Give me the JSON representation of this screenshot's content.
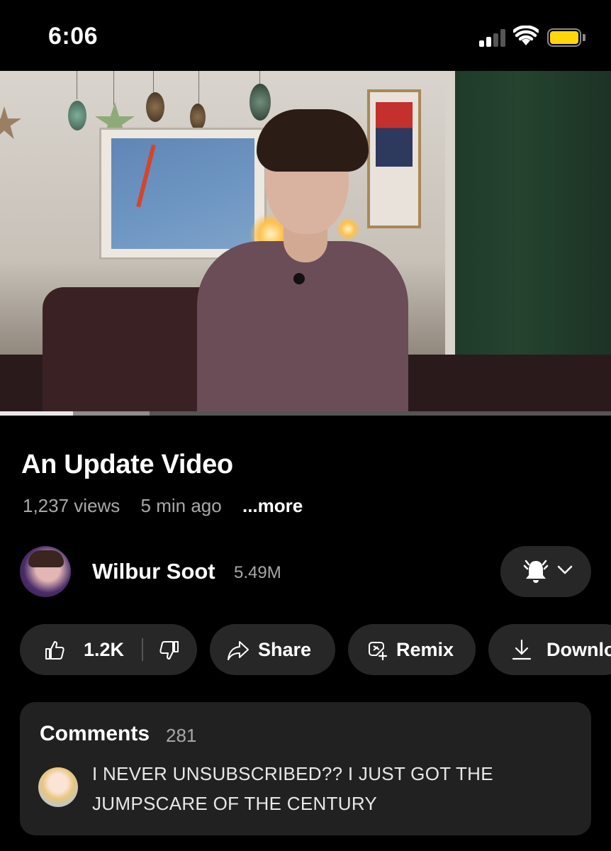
{
  "status_bar": {
    "time": "6:06",
    "battery_color": "#ffd60a",
    "icons": [
      "cellular-signal-icon",
      "wifi-icon",
      "battery-icon"
    ]
  },
  "video": {
    "progress_played_fraction": 0.12,
    "progress_buffered_fraction": 0.245
  },
  "details": {
    "title": "An Update Video",
    "views": "1,237 views",
    "age": "5 min ago",
    "more_label": "...more"
  },
  "channel": {
    "name": "Wilbur Soot",
    "subscribers": "5.49M",
    "bell_icon": "bell-icon",
    "chevron_icon": "chevron-down-icon"
  },
  "actions": {
    "like_count": "1.2K",
    "share_label": "Share",
    "remix_label": "Remix",
    "download_label": "Downlo"
  },
  "comments": {
    "heading": "Comments",
    "count": "281",
    "top_comment": "I NEVER UNSUBSCRIBED?? I JUST GOT THE JUMPSCARE OF THE CENTURY"
  },
  "colors": {
    "background": "#000000",
    "pill": "#272727",
    "comments_card": "#212121",
    "secondary_text": "#a8a8a8"
  }
}
